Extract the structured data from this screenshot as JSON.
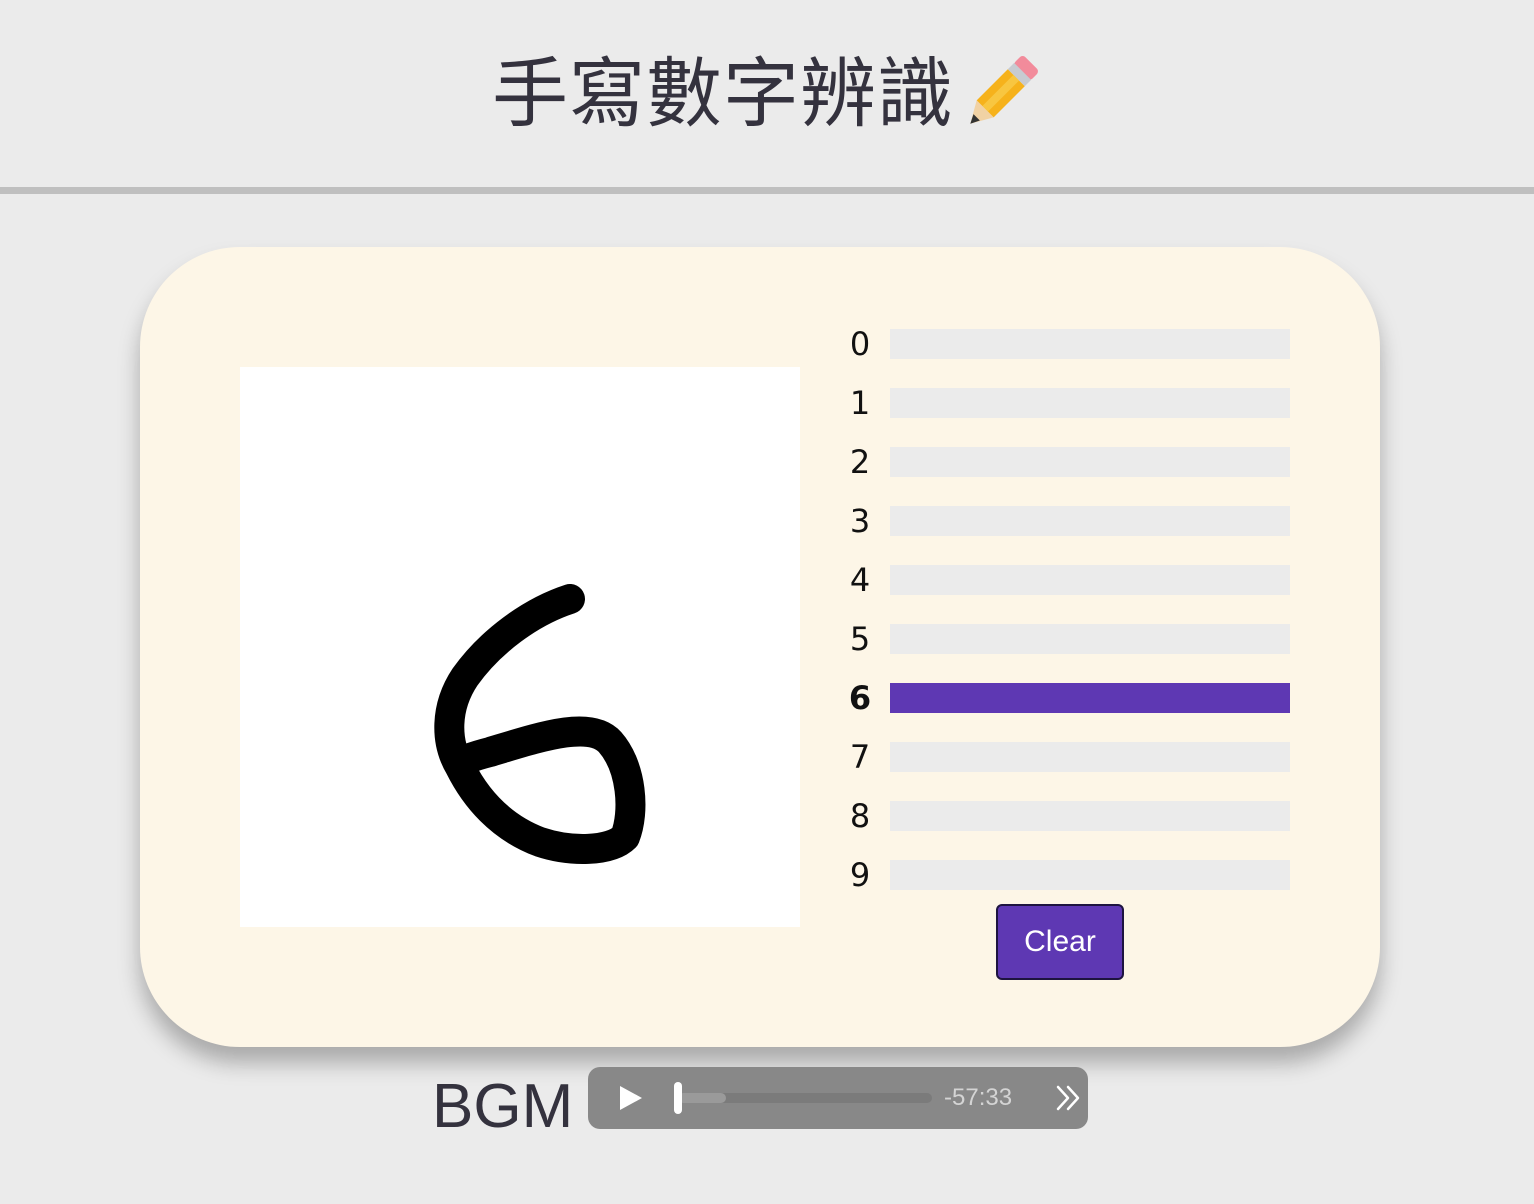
{
  "header": {
    "title": "手寫數字辨識",
    "title_icon": "pencil-icon"
  },
  "recognizer": {
    "digits": [
      {
        "label": "0",
        "probability": 0.0
      },
      {
        "label": "1",
        "probability": 0.0
      },
      {
        "label": "2",
        "probability": 0.0
      },
      {
        "label": "3",
        "probability": 0.0
      },
      {
        "label": "4",
        "probability": 0.0
      },
      {
        "label": "5",
        "probability": 0.0
      },
      {
        "label": "6",
        "probability": 1.0
      },
      {
        "label": "7",
        "probability": 0.0
      },
      {
        "label": "8",
        "probability": 0.0
      },
      {
        "label": "9",
        "probability": 0.0
      }
    ],
    "predicted": "6",
    "clear_label": "Clear"
  },
  "colors": {
    "accent": "#5e38b3",
    "track": "#ebebeb",
    "card": "#fdf6e7",
    "background": "#ebebeb"
  },
  "bgm": {
    "label": "BGM",
    "time_remaining": "-57:33",
    "play_icon": "play-icon",
    "more_icon": "double-chevron-right-icon",
    "played_fraction": 0.0,
    "buffered_fraction": 0.19
  }
}
